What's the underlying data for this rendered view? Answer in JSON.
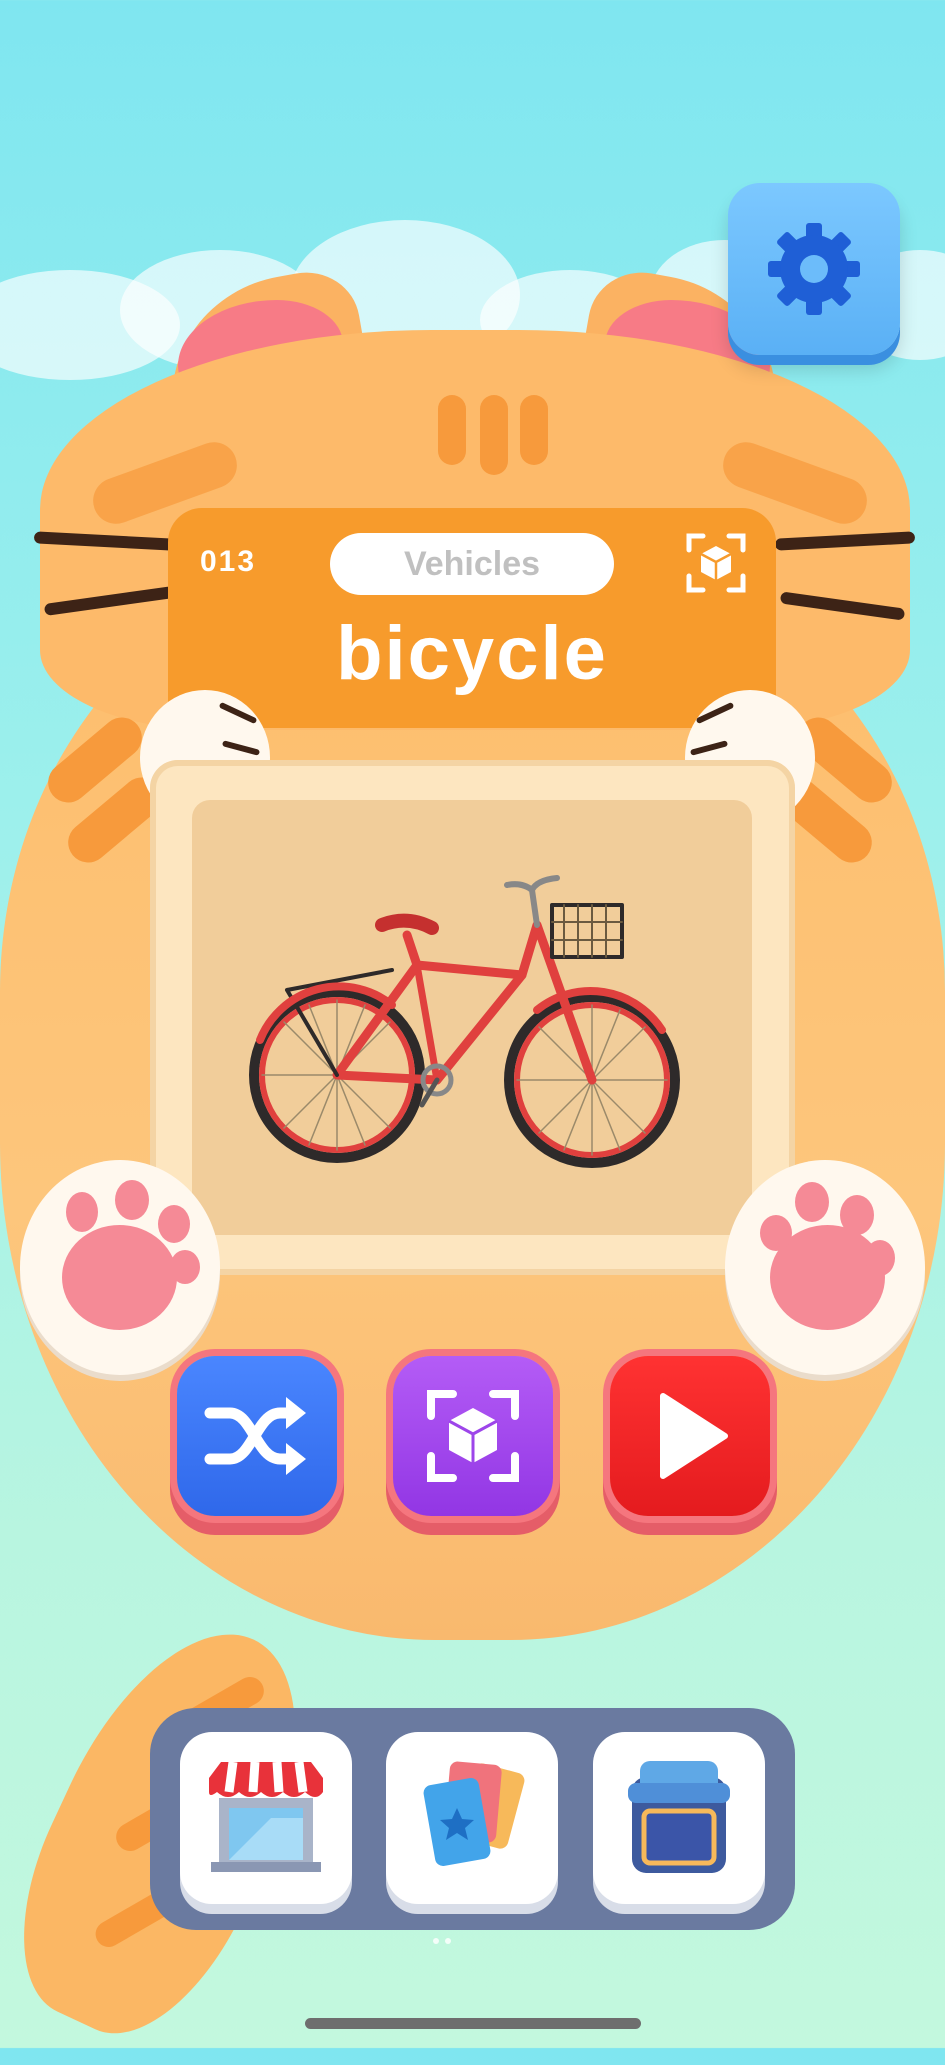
{
  "card": {
    "number": "013",
    "category": "Vehicles",
    "word": "bicycle"
  },
  "picture": {
    "subject": "bicycle",
    "frame_color": "#fde6c0",
    "bike_color": "#e0403e"
  },
  "icons": {
    "settings": "gear-icon",
    "ar_small": "ar-cube-icon",
    "shuffle": "shuffle-icon",
    "ar": "ar-cube-icon",
    "play": "play-icon",
    "shop": "shop-icon",
    "cards": "cards-icon",
    "album": "album-icon"
  },
  "colors": {
    "header_orange": "#f79b2c",
    "shuffle_blue": "#2f68ea",
    "ar_purple": "#9236e4",
    "play_red": "#e41b1e",
    "nav_bg": "#6a7aa0",
    "settings_blue": "#5ab0f5"
  }
}
